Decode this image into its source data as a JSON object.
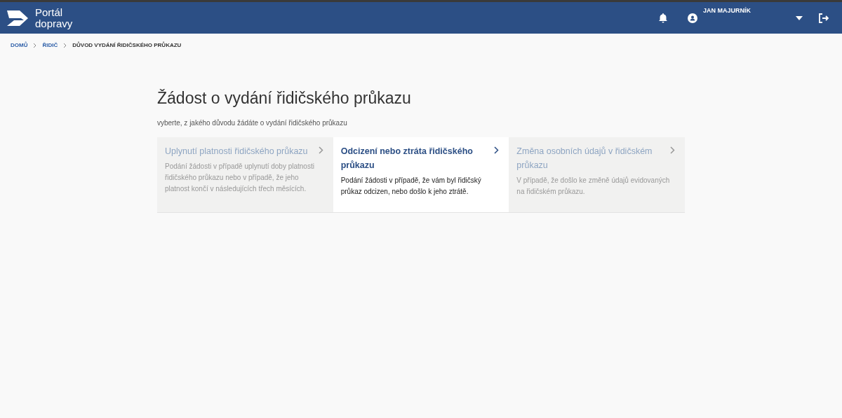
{
  "header": {
    "logo_text": [
      "Portál",
      "dopravy"
    ],
    "user_name": "JAN MAJURNÍK"
  },
  "breadcrumb": [
    {
      "label": "DOMŮ",
      "link": true
    },
    {
      "label": "ŘIDIČ",
      "link": true
    },
    {
      "label": "DŮVOD VYDÁNÍ ŘIDIČSKÉHO PRŮKAZU",
      "link": false
    }
  ],
  "title": "Žádost o vydání řidičského průkazu",
  "subtitle": "vyberte, z jakého důvodu žádáte o vydání řidičského průkazu",
  "options": [
    {
      "title": "Uplynutí platnosti řidičského průkazu",
      "description": "Podání žádosti v případě uplynutí doby platnosti řidičského průkazu nebo v případě, že jeho platnost končí v následujících třech měsících.",
      "disabled": true
    },
    {
      "title": "Odcizení nebo ztráta řidičského průkazu",
      "description": "Podání žádosti v případě, že vám byl řidičský průkaz odcizen, nebo došlo k jeho ztrátě.",
      "disabled": false
    },
    {
      "title": "Změna osobních údajů v řidičském průkazu",
      "description": "V případě, že došlo ke změně údajů evidovaných na řidičském průkazu.",
      "disabled": true
    }
  ]
}
